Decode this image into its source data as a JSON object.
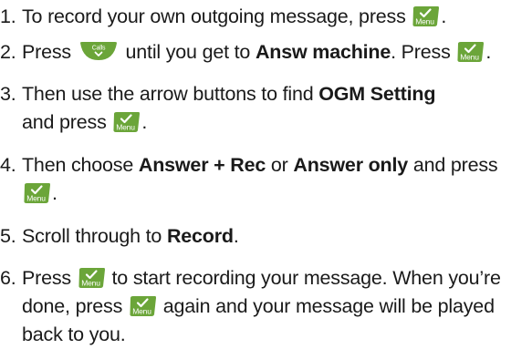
{
  "colors": {
    "key_green": "#6ba539",
    "key_green_dark": "#4f8a27",
    "text": "#1a1a1a"
  },
  "icons": {
    "menu_key": "menu-key-icon",
    "calls_key": "calls-key-icon"
  },
  "keys": {
    "menu_label": "Menu",
    "calls_label": "Calls"
  },
  "steps": [
    {
      "num": "1.",
      "t1": "To record your own outgoing message, press",
      "t2": "."
    },
    {
      "num": "2.",
      "t1": "Press",
      "t2": "until you get to",
      "b1": "Answ machine",
      "t3": ". Press",
      "t4": "."
    },
    {
      "num": "3.",
      "t1": "Then use the arrow buttons to find",
      "b1": "OGM Setting",
      "t2": "and press",
      "t3": "."
    },
    {
      "num": "4.",
      "t1": "Then choose",
      "b1": "Answer + Rec",
      "t2": "or",
      "b2": "Answer only",
      "t3": "and press",
      "t4": "."
    },
    {
      "num": "5.",
      "t1": "Scroll through to",
      "b1": "Record",
      "t2": "."
    },
    {
      "num": "6.",
      "t1": "Press",
      "t2": "to start recording your message. When you’re done, press",
      "t3": "again and your message will be played back to you."
    }
  ]
}
